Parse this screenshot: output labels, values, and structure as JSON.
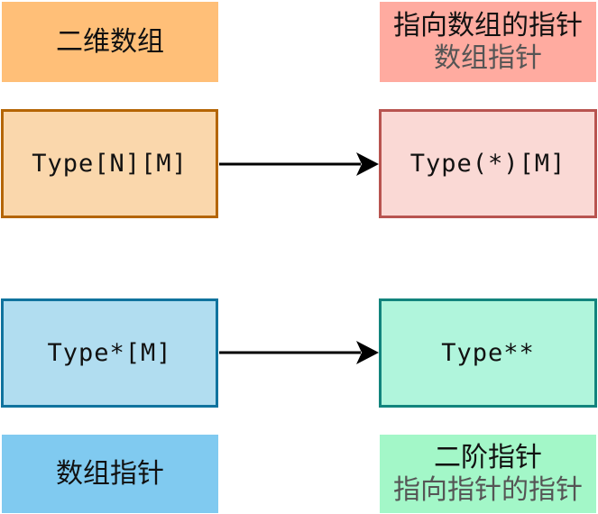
{
  "legend_top_left": {
    "line1": "二维数组"
  },
  "legend_top_right": {
    "line1": "指向数组的指针",
    "line2": "数组指针"
  },
  "row1": {
    "left": "Type[N][M]",
    "right": "Type(*)[M]"
  },
  "row2": {
    "left": "Type*[M]",
    "right": "Type**"
  },
  "legend_bottom_left": {
    "line1": "数组指针"
  },
  "legend_bottom_right": {
    "line1": "二阶指针",
    "line2": "指向指针的指针"
  },
  "colors": {
    "orange_fill": "#ffbf78",
    "salmon_fill": "#ffaba0",
    "peach_fill": "#fad7ac",
    "peach_stroke": "#b46504",
    "pink_fill": "#fad9d5",
    "pink_stroke": "#b85450",
    "blue_fill": "#b1ddf0",
    "blue_stroke": "#10739e",
    "mint_fill": "#b0f5dc",
    "mint_stroke": "#12847d",
    "sky_fill": "#80caf0",
    "green_fill": "#a3f7c8"
  }
}
